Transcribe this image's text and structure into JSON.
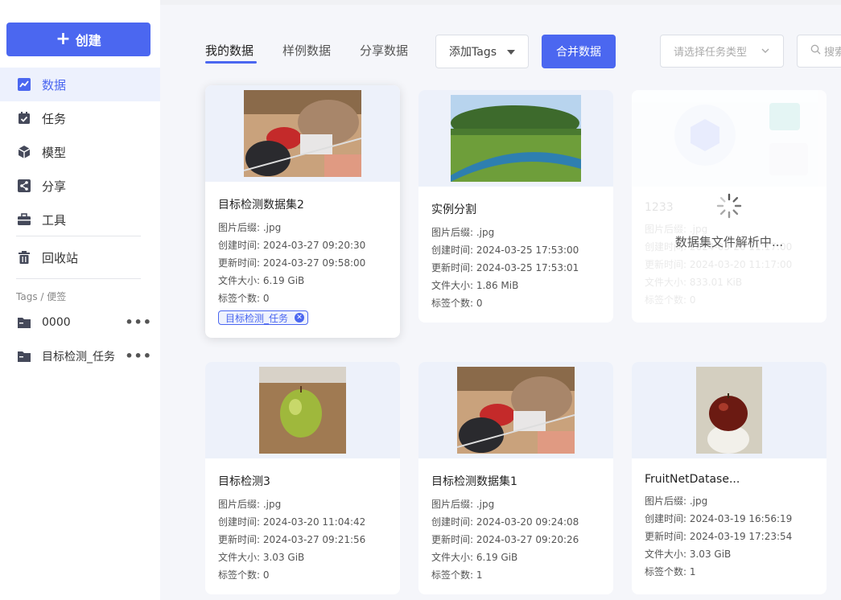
{
  "sidebar": {
    "create_label": "创建",
    "items": [
      {
        "label": "数据",
        "icon": "chart-icon"
      },
      {
        "label": "任务",
        "icon": "calendar-check-icon"
      },
      {
        "label": "模型",
        "icon": "cube-icon"
      },
      {
        "label": "分享",
        "icon": "share-icon"
      },
      {
        "label": "工具",
        "icon": "toolbox-icon"
      },
      {
        "label": "回收站",
        "icon": "trash-icon"
      }
    ],
    "tags_title": "Tags / 便签",
    "tags": [
      {
        "label": "0000"
      },
      {
        "label": "目标检测_任务"
      }
    ]
  },
  "tabs": [
    {
      "label": "我的数据"
    },
    {
      "label": "样例数据"
    },
    {
      "label": "分享数据"
    }
  ],
  "toolbar": {
    "add_tags_label": "添加Tags",
    "merge_label": "合并数据",
    "type_placeholder": "请选择任务类型",
    "search_placeholder": "搜索"
  },
  "labels": {
    "suffix": "图片后缀: ",
    "created": "创建时间: ",
    "updated": "更新时间: ",
    "size": "文件大小: ",
    "tag_count": "标签个数: "
  },
  "cards": [
    {
      "title": "目标检测数据集2",
      "suffix": ".jpg",
      "created": "2024-03-27 09:20:30",
      "updated": "2024-03-27 09:58:00",
      "size": "6.19 GiB",
      "tag_count": "0",
      "tag": "目标检测_任务"
    },
    {
      "title": "实例分割",
      "suffix": ".jpg",
      "created": "2024-03-25 17:53:00",
      "updated": "2024-03-25 17:53:01",
      "size": "1.86 MiB",
      "tag_count": "0"
    },
    {
      "title": "1233",
      "suffix": ".jpg",
      "created": "2024-03-20 11:17:00",
      "updated": "2024-03-20 11:17:00",
      "size": "833.01 KiB",
      "tag_count": "0",
      "loading_text": "数据集文件解析中..."
    },
    {
      "title": "目标检测3",
      "suffix": ".jpg",
      "created": "2024-03-20 11:04:42",
      "updated": "2024-03-27 09:21:56",
      "size": "3.03 GiB",
      "tag_count": "0"
    },
    {
      "title": "目标检测数据集1",
      "suffix": ".jpg",
      "created": "2024-03-20 09:24:08",
      "updated": "2024-03-27 09:20:26",
      "size": "6.19 GiB",
      "tag_count": "1"
    },
    {
      "title": "FruitNetDatase...",
      "suffix": ".jpg",
      "created": "2024-03-19 16:56:19",
      "updated": "2024-03-19 17:23:54",
      "size": "3.03 GiB",
      "tag_count": "1"
    }
  ],
  "colors": {
    "accent": "#4b67f0"
  }
}
